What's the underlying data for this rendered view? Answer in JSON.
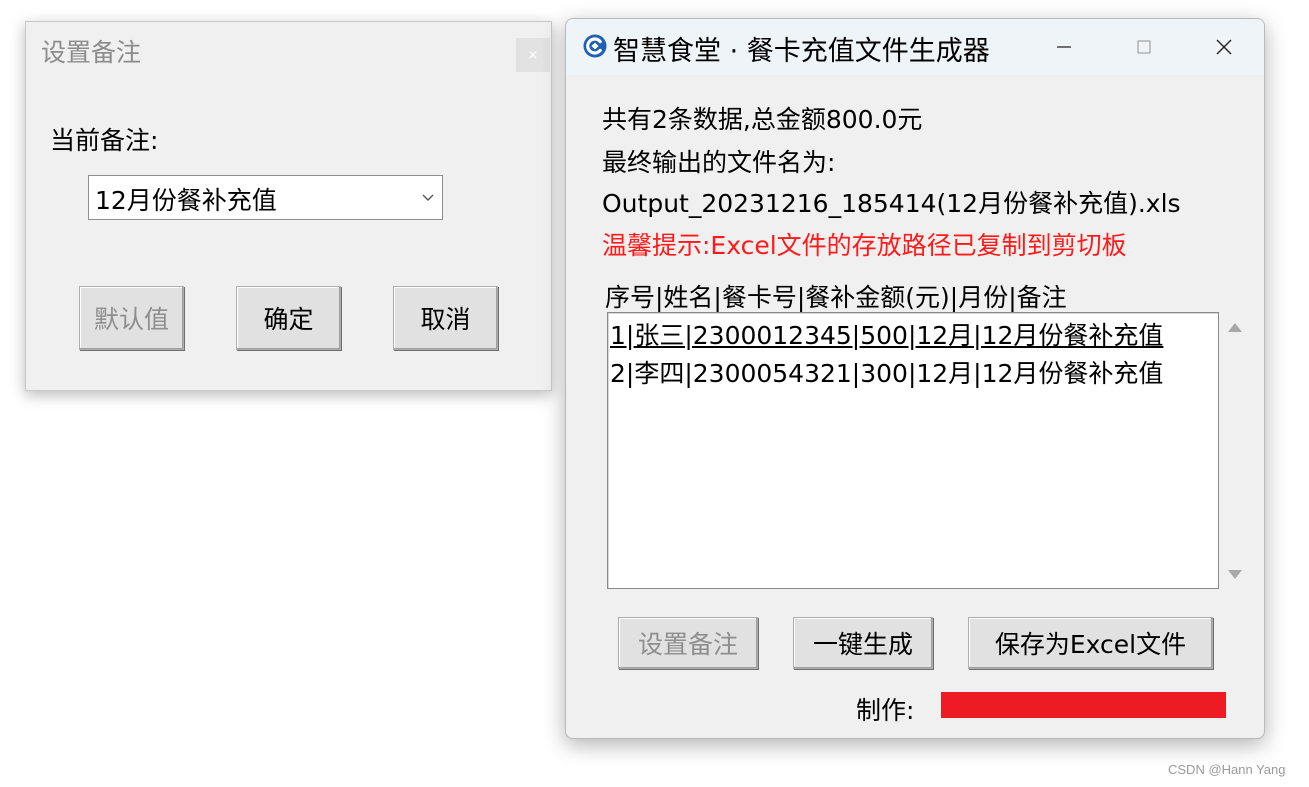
{
  "remark_dialog": {
    "title": "设置备注",
    "close_icon": "×",
    "label": "当前备注:",
    "combo_value": "12月份餐补充值",
    "buttons": {
      "default": "默认值",
      "ok": "确定",
      "cancel": "取消"
    }
  },
  "main_window": {
    "title": "智慧食堂 · 餐卡充值文件生成器",
    "summary": "共有2条数据,总金额800.0元",
    "output_label": "最终输出的文件名为:",
    "output_filename": "Output_20231216_185414(12月份餐补充值).xls",
    "tip": "温馨提示:Excel文件的存放路径已复制到剪切板",
    "list_header": "序号|姓名|餐卡号|餐补金额(元)|月份|备注",
    "list_rows": [
      "1|张三|2300012345|500|12月|12月份餐补充值",
      "2|李四|2300054321|300|12月|12月份餐补充值"
    ],
    "buttons": {
      "set_remark": "设置备注",
      "generate": "一键生成",
      "save_excel": "保存为Excel文件"
    },
    "credit_label": "制作:",
    "credit_value_redacted": "██████████"
  },
  "watermark": "CSDN @Hann Yang",
  "colors": {
    "warning_text": "#ff1a1a",
    "redaction": "#ed1c24",
    "titlebar": "#eff4f9",
    "app_icon": "#1f5fb4"
  }
}
